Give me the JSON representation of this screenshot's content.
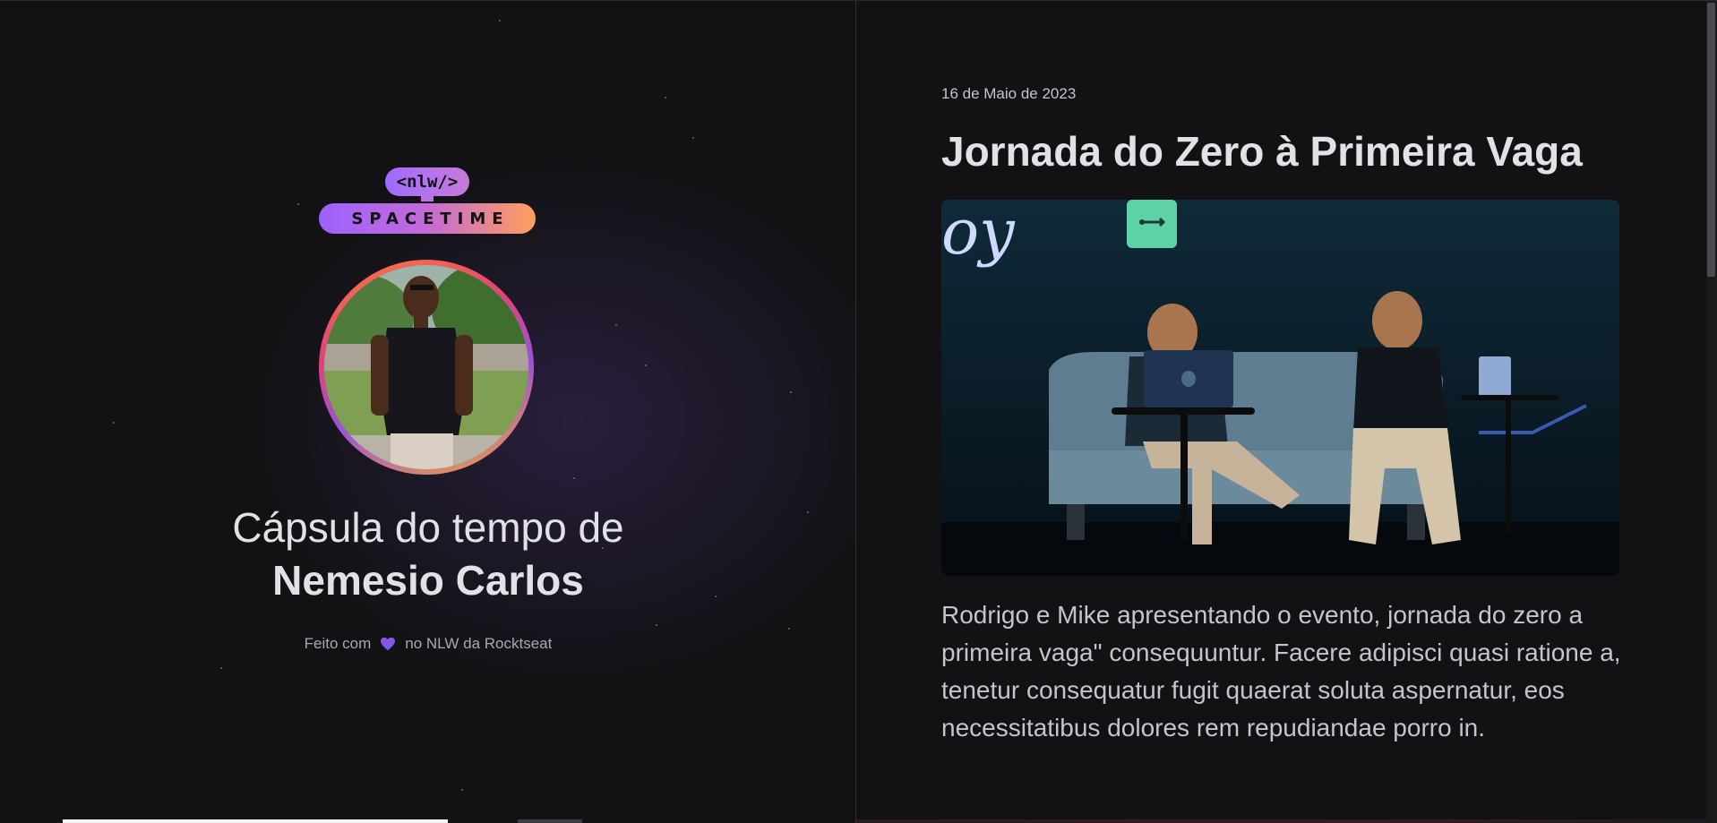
{
  "brand": {
    "logo_top": "<nlw/>",
    "logo_bottom": "SPACETIME",
    "gradient_colors": [
      "#9b62ff",
      "#c46ad8",
      "#ff9f5a"
    ]
  },
  "profile": {
    "title_prefix": "Cápsula do tempo de",
    "name": "Nemesio Carlos",
    "avatar": "avatar-photo"
  },
  "footer": {
    "before_icon": "Feito com",
    "icon": "heart-icon",
    "after_icon": "no NLW da Rocktseat",
    "icon_color": "#8257e5"
  },
  "memory": {
    "date": "16 de Maio de 2023",
    "title": "Jornada do Zero à Primeira Vaga",
    "image": "event-photo",
    "body": "Rodrigo e Mike apresentando o evento, jornada do zero a primeira vaga\" consequuntur. Facere adipisci quasi ratione a, tenetur consequatur fugit quaerat soluta aspernatur, eos necessitatibus dolores rem repudiandae porro in."
  }
}
